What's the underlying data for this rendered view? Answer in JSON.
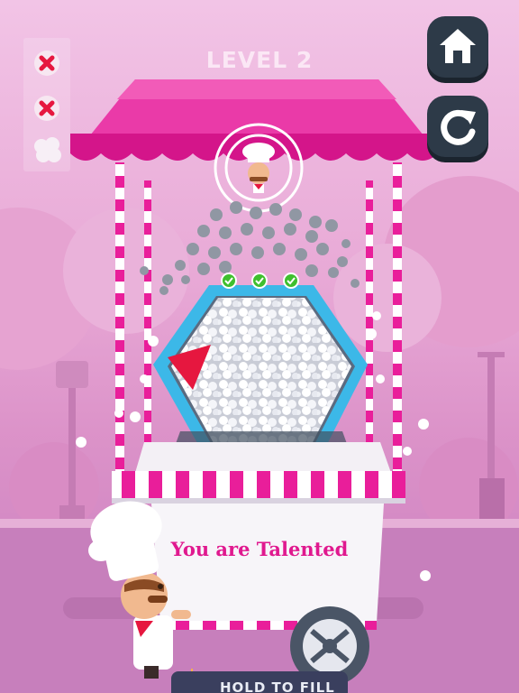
{
  "hud": {
    "level_label": "LEVEL 2",
    "attempts": [
      "fail",
      "fail",
      "remaining"
    ],
    "home_button": "home-icon",
    "restart_button": "restart-icon"
  },
  "cart": {
    "banner_text": "You are Talented",
    "target_checks": 3
  },
  "hold_button": {
    "label": "HOLD TO FILL",
    "icon": "hand-pointer-icon"
  },
  "colors": {
    "awning": "#e91e9a",
    "container_rim": "#3cb8e8",
    "fail_mark": "#e6173f",
    "check": "#3fbf2e",
    "button": "#2d3a48"
  }
}
